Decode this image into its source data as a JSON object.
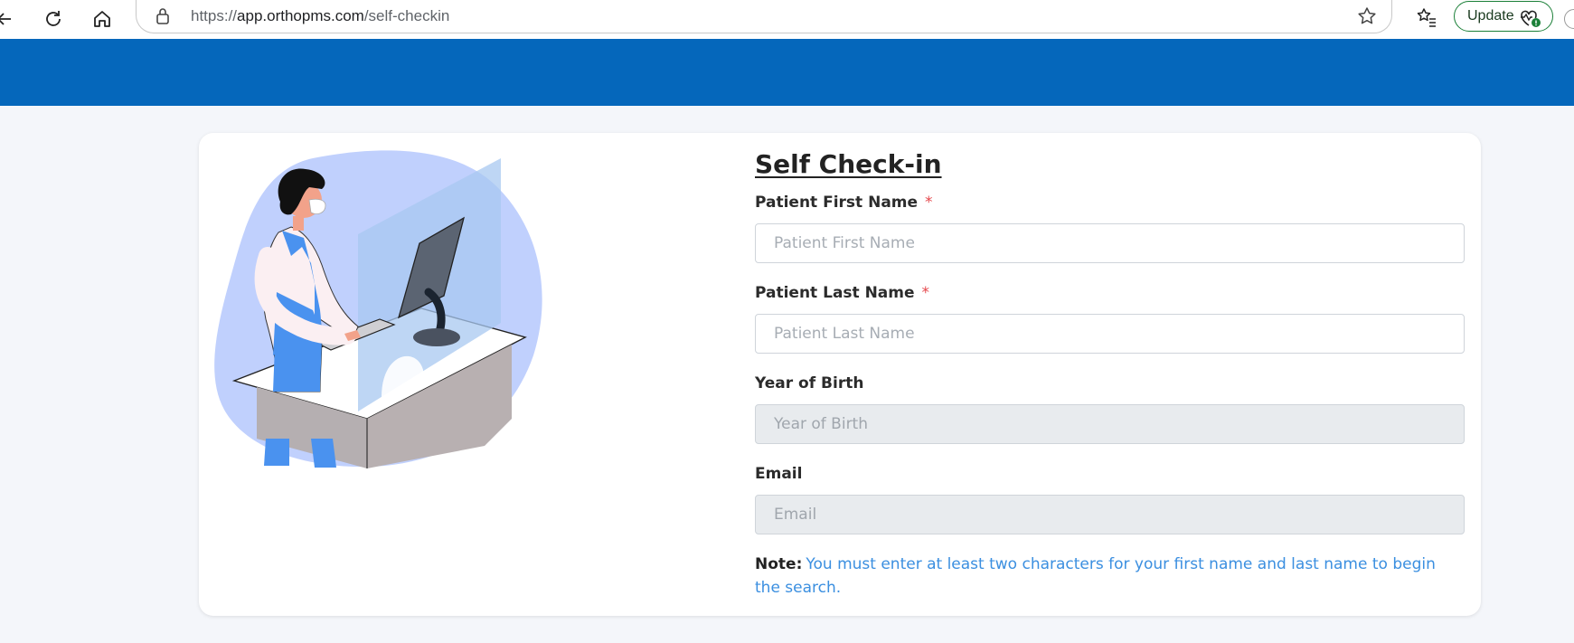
{
  "browser": {
    "url_scheme": "https://",
    "url_host": "app.orthopms.com",
    "url_path": "/self-checkin",
    "update_label": "Update",
    "icons": [
      "back-arrow-icon",
      "reload-icon",
      "home-icon",
      "lock-icon",
      "star-icon",
      "favorites-icon",
      "heart-pulse-icon"
    ]
  },
  "form": {
    "title": "Self Check-in",
    "fields": [
      {
        "label": "Patient First Name",
        "placeholder": "Patient First Name",
        "required": "*"
      },
      {
        "label": "Patient Last Name",
        "placeholder": "Patient Last Name",
        "required": "*"
      },
      {
        "label": "Year of Birth",
        "placeholder": "Year of Birth"
      },
      {
        "label": "Email",
        "placeholder": "Email"
      }
    ],
    "note_label": "Note:",
    "note_text": "You must enter at least two characters for your first name and last name to begin the search."
  },
  "colors": {
    "header_blue": "#0567bb",
    "required_red": "#e5484d",
    "note_blue": "#3b8fe0",
    "update_border": "#1a7f37"
  }
}
